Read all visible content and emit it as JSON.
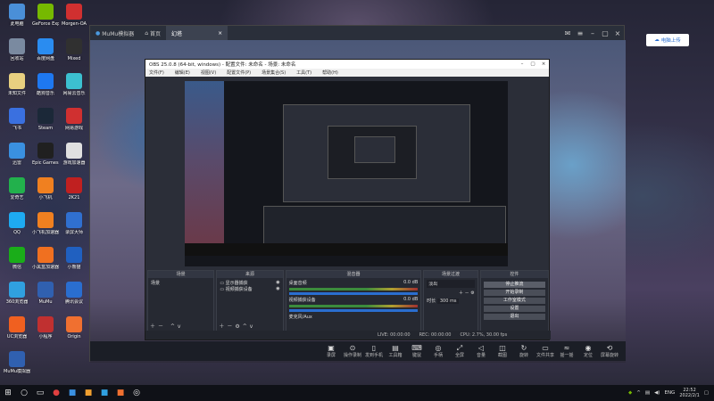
{
  "desktop": {
    "icons": [
      {
        "label": "此电脑",
        "color": "#4a8fd8"
      },
      {
        "label": "GeForce Experience",
        "color": "#76b900"
      },
      {
        "label": "Morgen-OA",
        "color": "#d03030"
      },
      {
        "label": "回收站",
        "color": "#7a8aa0"
      },
      {
        "label": "百度网盘",
        "color": "#2a8cf0"
      },
      {
        "label": "Mixed",
        "color": "#303030"
      },
      {
        "label": "未知文件",
        "color": "#e8d080"
      },
      {
        "label": "酷狗音乐",
        "color": "#1e78f0"
      },
      {
        "label": "网易云音乐",
        "color": "#3cc0d0"
      },
      {
        "label": "飞书",
        "color": "#3a70e0"
      },
      {
        "label": "Steam",
        "color": "#1b2838"
      },
      {
        "label": "网易游戏",
        "color": "#d03030"
      },
      {
        "label": "迅雷",
        "color": "#3a90e0"
      },
      {
        "label": "Epic Games Launcher",
        "color": "#202020"
      },
      {
        "label": "游戏加速器",
        "color": "#e0e0e0"
      },
      {
        "label": "爱奇艺",
        "color": "#22b14c"
      },
      {
        "label": "小飞机",
        "color": "#f08020"
      },
      {
        "label": "2K21",
        "color": "#c02020"
      },
      {
        "label": "QQ",
        "color": "#1eaaf1"
      },
      {
        "label": "小飞机加速器",
        "color": "#f08020"
      },
      {
        "label": "录屏大师",
        "color": "#3070d0"
      },
      {
        "label": "微信",
        "color": "#1aad19"
      },
      {
        "label": "小黑盒加速器",
        "color": "#f07020"
      },
      {
        "label": "小熊猫",
        "color": "#2060c0"
      },
      {
        "label": "360浏览器",
        "color": "#30a0e0"
      },
      {
        "label": "MuMu",
        "color": "#3060b0"
      },
      {
        "label": "腾讯会议",
        "color": "#2a6ed0"
      },
      {
        "label": "UC浏览器",
        "color": "#f06020"
      },
      {
        "label": "小程序",
        "color": "#c03030"
      },
      {
        "label": "Origin",
        "color": "#f07030"
      },
      {
        "label": "MuMu模拟器",
        "color": "#3060b0"
      }
    ]
  },
  "mumu": {
    "app_name": "MuMu模拟器",
    "tabs": [
      {
        "label": "首页"
      },
      {
        "label": "幻塔"
      }
    ],
    "toolbar": [
      {
        "label": "录屏",
        "icon": "video-icon"
      },
      {
        "label": "操作录制",
        "icon": "macro-icon"
      },
      {
        "label": "发到手机",
        "icon": "phone-icon"
      },
      {
        "label": "工具箱",
        "icon": "toolbox-icon"
      },
      {
        "label": "键鼠",
        "icon": "keyboard-icon"
      },
      {
        "label": "手柄",
        "icon": "gamepad-icon"
      },
      {
        "label": "全屏",
        "icon": "fullscreen-icon"
      },
      {
        "label": "音量",
        "icon": "volume-icon"
      },
      {
        "label": "截图",
        "icon": "screenshot-icon"
      },
      {
        "label": "旋转",
        "icon": "rotate-icon"
      },
      {
        "label": "文件共享",
        "icon": "folder-icon"
      },
      {
        "label": "摇一摇",
        "icon": "shake-icon"
      },
      {
        "label": "定位",
        "icon": "location-icon"
      },
      {
        "label": "屏幕旋转",
        "icon": "screen-rotate-icon"
      }
    ]
  },
  "side_button": {
    "label": "电脑上传"
  },
  "obs": {
    "title": "OBS 25.0.8 (64-bit, windows) - 配置文件: 未命名 - 场景: 未命名",
    "menu": [
      "文件(F)",
      "编辑(E)",
      "视图(V)",
      "配置文件(P)",
      "场景集合(S)",
      "工具(T)",
      "帮助(H)"
    ],
    "docks": {
      "scenes": {
        "title": "场景",
        "items": [
          "场景"
        ]
      },
      "sources": {
        "title": "来源",
        "items": [
          "显示器捕获",
          "视频捕获设备"
        ]
      },
      "mixer": {
        "title": "混音器",
        "channels": [
          {
            "name": "桌面音频",
            "db": "0.0 dB"
          },
          {
            "name": "视频捕获设备",
            "db": "0.0 dB"
          },
          {
            "name": "麦克风/Aux",
            "db": ""
          }
        ]
      },
      "transitions": {
        "title": "场景过渡",
        "type": "淡出",
        "duration_label": "时长",
        "duration": "300 ms"
      },
      "controls": {
        "title": "控件",
        "buttons": [
          "停止推流",
          "开始录制",
          "工作室模式",
          "设置",
          "退出"
        ]
      }
    },
    "status": {
      "live": "LIVE: 00:00:00",
      "rec": "REC: 00:00:00",
      "cpu": "CPU: 2.7%, 30.00 fps"
    }
  },
  "taskbar": {
    "time": "22:52",
    "date": "2022/2/1",
    "lang": "ENG"
  }
}
